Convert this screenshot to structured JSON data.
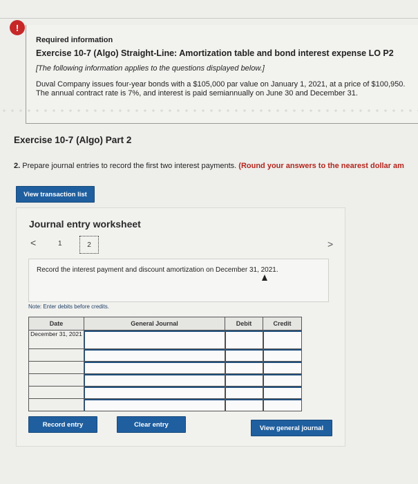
{
  "info": {
    "alert_symbol": "!",
    "required": "Required information",
    "title": "Exercise 10-7 (Algo) Straight-Line: Amortization table and bond interest expense LO P2",
    "italic_note": "[The following information applies to the questions displayed below.]",
    "paragraph": "Duval Company issues four-year bonds with a $105,000 par value on January 1, 2021, at a price of $100,950. The annual contract rate is 7%, and interest is paid semiannually on June 30 and December 31."
  },
  "part_title": "Exercise 10-7 (Algo) Part 2",
  "question": {
    "number": "2.",
    "text": " Prepare journal entries to record the first two interest payments. ",
    "instruction": "(Round your answers to the nearest dollar am"
  },
  "buttons": {
    "view_transaction_list": "View transaction list",
    "record_entry": "Record entry",
    "clear_entry": "Clear entry",
    "view_general_journal": "View general journal"
  },
  "worksheet": {
    "title": "Journal entry worksheet",
    "prev": "<",
    "next": ">",
    "pages": [
      "1",
      "2"
    ],
    "current_page": 2,
    "description": "Record the interest payment and discount amortization on December 31, 2021.",
    "note": "Note: Enter debits before credits.",
    "columns": [
      "Date",
      "General Journal",
      "Debit",
      "Credit"
    ],
    "rows": [
      {
        "date": "December 31, 2021"
      },
      {
        "date": ""
      },
      {
        "date": ""
      },
      {
        "date": ""
      },
      {
        "date": ""
      },
      {
        "date": ""
      }
    ]
  },
  "colors": {
    "button": "#1f5f9f",
    "alert": "#c62828",
    "instruction_red": "#b3251e"
  }
}
